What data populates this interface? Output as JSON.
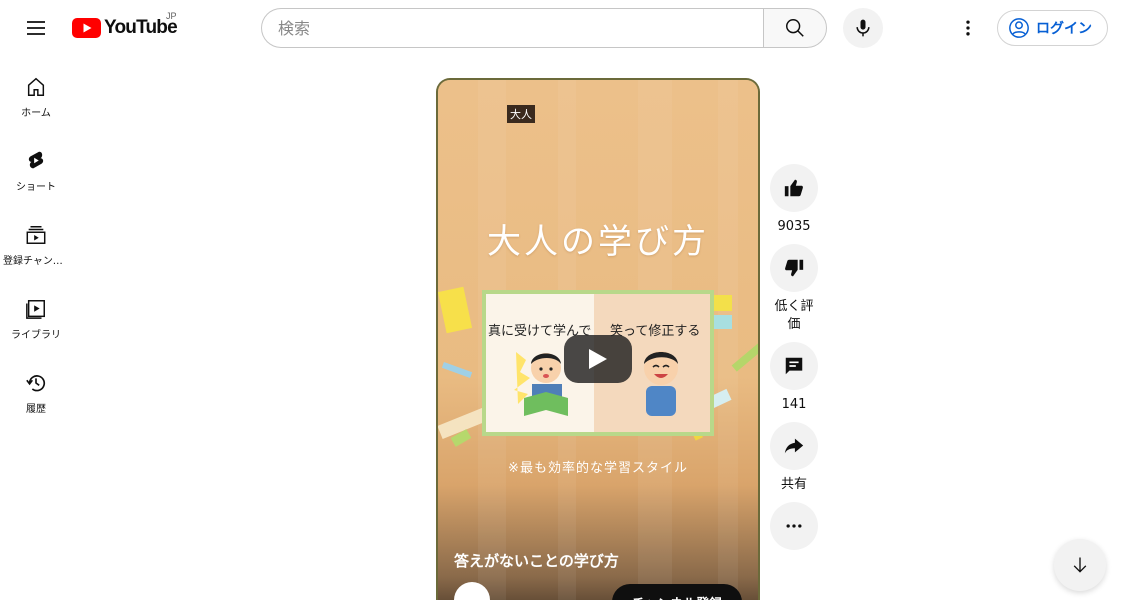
{
  "header": {
    "logo_text": "YouTube",
    "region": "JP",
    "search_placeholder": "検索",
    "login_label": "ログイン"
  },
  "sidebar": {
    "items": [
      {
        "label": "ホーム",
        "icon": "home-icon"
      },
      {
        "label": "ショート",
        "icon": "shorts-icon"
      },
      {
        "label": "登録チャンネル",
        "icon": "subscriptions-icon"
      },
      {
        "label": "ライブラリ",
        "icon": "library-icon"
      },
      {
        "label": "履歴",
        "icon": "history-icon"
      }
    ]
  },
  "video": {
    "badge": "大人",
    "main_title": "大人の学び方",
    "board_left": "真に受けて学んで",
    "board_right": "笑って修正する",
    "subtitle": "※最も効率的な学習スタイル",
    "title": "答えがないことの学び方",
    "subscribe_label": "チャンネル登録"
  },
  "actions": {
    "like_count": "9035",
    "dislike_label": "低く評価",
    "comment_count": "141",
    "share_label": "共有"
  },
  "colors": {
    "brand_red": "#ff0000",
    "link_blue": "#065fd4",
    "button_bg": "#f2f2f2"
  }
}
